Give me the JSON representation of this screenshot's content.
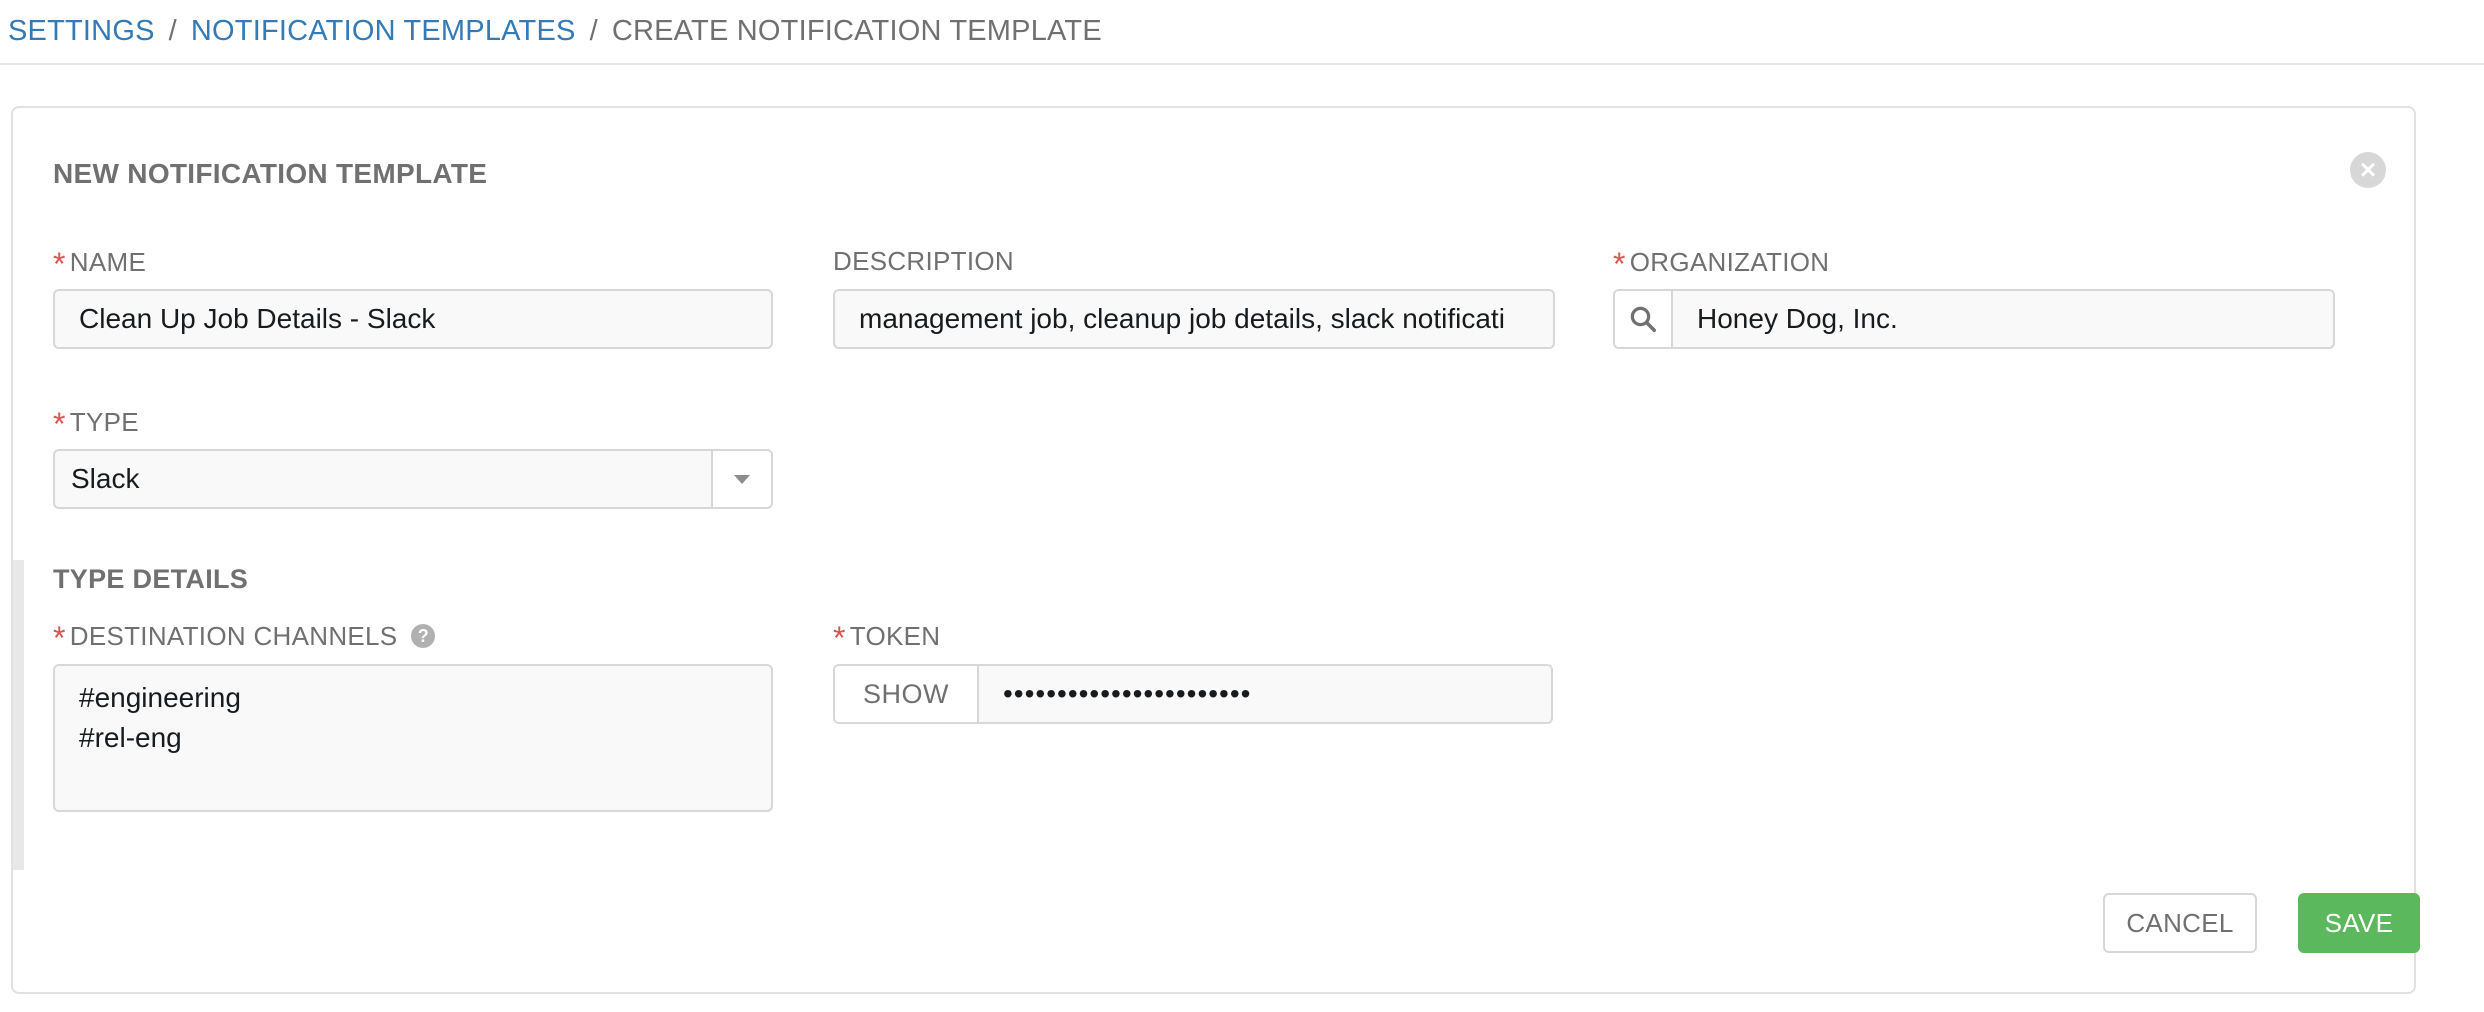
{
  "breadcrumb": {
    "items": [
      {
        "label": "SETTINGS"
      },
      {
        "label": "NOTIFICATION TEMPLATES"
      },
      {
        "label": "CREATE NOTIFICATION TEMPLATE"
      }
    ],
    "separator": "/"
  },
  "panel": {
    "title": "NEW NOTIFICATION TEMPLATE",
    "close_icon": "×"
  },
  "form": {
    "name": {
      "label": "NAME",
      "required": true,
      "value": "Clean Up Job Details - Slack"
    },
    "description": {
      "label": "DESCRIPTION",
      "required": false,
      "value": "management job, cleanup job details, slack notificati"
    },
    "organization": {
      "label": "ORGANIZATION",
      "required": true,
      "value": "Honey Dog, Inc.",
      "icon": "search-icon"
    },
    "type": {
      "label": "TYPE",
      "required": true,
      "value": "Slack",
      "icon": "chevron-down-icon"
    }
  },
  "type_details": {
    "title": "TYPE DETAILS",
    "destination_channels": {
      "label": "DESTINATION CHANNELS",
      "required": true,
      "help_icon": "?",
      "value": "#engineering\n#rel-eng"
    },
    "token": {
      "label": "TOKEN",
      "required": true,
      "show_label": "SHOW",
      "value": "•••••••••••••••••••••••"
    }
  },
  "actions": {
    "cancel_label": "CANCEL",
    "save_label": "SAVE"
  },
  "colors": {
    "link": "#337ab7",
    "required": "#d9534f",
    "save": "#5cb85c"
  },
  "required_marker": "*"
}
